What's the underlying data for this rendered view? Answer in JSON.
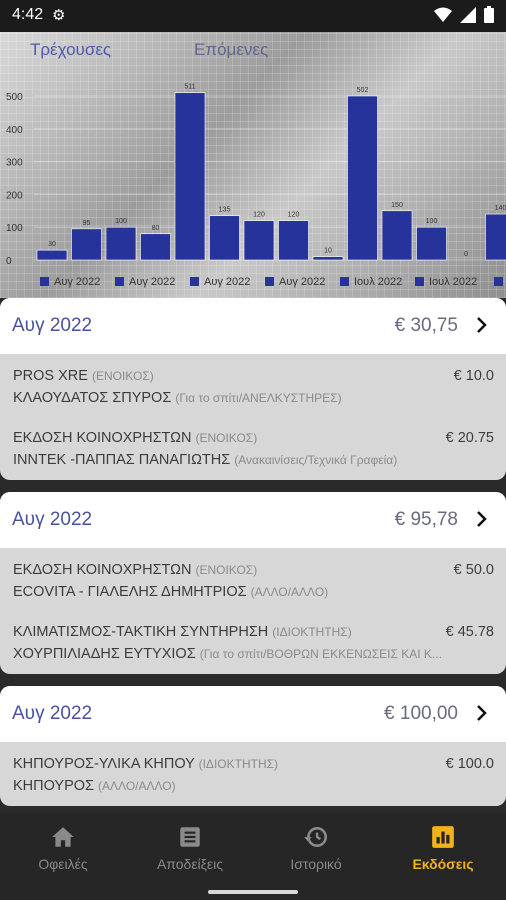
{
  "status": {
    "time": "4:42"
  },
  "chart_tabs": {
    "current": "Τρέχουσες",
    "next": "Επόμενες"
  },
  "chart_data": {
    "type": "bar",
    "values": [
      30,
      95,
      100,
      80,
      510,
      135,
      120,
      120,
      10,
      500,
      150,
      100,
      0,
      140
    ],
    "value_labels": [
      "30",
      "95",
      "100",
      "80",
      "511",
      "135",
      "120",
      "120",
      "10",
      "502",
      "150",
      "100",
      "0",
      "140"
    ],
    "ylim": [
      0,
      520
    ],
    "yticks": [
      0,
      100,
      200,
      300,
      400,
      500
    ],
    "legend": [
      "Αυγ 2022",
      "Αυγ 2022",
      "Αυγ 2022",
      "Αυγ 2022",
      "Ιουλ 2022",
      "Ιουλ 2022"
    ],
    "color": "#26339a"
  },
  "cards": [
    {
      "month": "Αυγ 2022",
      "total": "€ 30,75",
      "items": [
        {
          "title": "PROS XRE",
          "role": "(ΕΝΟΙΚΟΣ)",
          "amount": "€ 10.0",
          "vendor": "ΚΛΑΟΥΔΑΤΟΣ  ΣΠΥΡΟΣ",
          "category": "(Για το σπίτι/ΑΝΕΛΚΥΣΤΗΡΕΣ)"
        },
        {
          "title": "ΕΚΔΟΣΗ ΚΟΙΝΟΧΡΗΣΤΩΝ",
          "role": "(ΕΝΟΙΚΟΣ)",
          "amount": "€ 20.75",
          "vendor": "ΙΝΝΤΕΚ -ΠΑΠΠΑΣ ΠΑΝΑΓΙΩΤΗΣ",
          "category": "(Ανακαινίσεις/Τεχνικά Γραφεία)"
        }
      ]
    },
    {
      "month": "Αυγ 2022",
      "total": "€ 95,78",
      "items": [
        {
          "title": "ΕΚΔΟΣΗ ΚΟΙΝΟΧΡΗΣΤΩΝ",
          "role": "(ΕΝΟΙΚΟΣ)",
          "amount": "€ 50.0",
          "vendor": "ECOVITA - ΓΙΑΛΕΛΗΣ ΔΗΜΗΤΡΙΟΣ",
          "category": "(ΑΛΛΟ/ΑΛΛΟ)"
        },
        {
          "title": "ΚΛΙΜΑΤΙΣΜΟΣ-ΤΑΚΤΙΚΗ ΣΥΝΤΗΡΗΣΗ",
          "role": "(ΙΔΙΟΚΤΗΤΗΣ)",
          "amount": "€ 45.78",
          "vendor": "ΧΟΥΡΠΙΛΙΑΔΗΣ ΕΥΤΥΧΙΟΣ",
          "category": "(Για το σπίτι/ΒΟΘΡΩΝ ΕΚΚΕΝΩΣΕΙΣ ΚΑΙ Κ..."
        }
      ]
    },
    {
      "month": "Αυγ 2022",
      "total": "€ 100,00",
      "items": [
        {
          "title": "ΚΗΠΟΥΡΟΣ-ΥΛΙΚΑ ΚΗΠΟΥ",
          "role": "(ΙΔΙΟΚΤΗΤΗΣ)",
          "amount": "€ 100.0",
          "vendor": "ΚΗΠΟΥΡΟΣ",
          "category": "(ΑΛΛΟ/ΑΛΛΟ)"
        }
      ]
    }
  ],
  "nav": [
    {
      "label": "Οφειλές",
      "icon": "home-icon"
    },
    {
      "label": "Αποδείξεις",
      "icon": "receipt-icon"
    },
    {
      "label": "Ιστορικό",
      "icon": "history-icon"
    },
    {
      "label": "Εκδόσεις",
      "icon": "chart-icon"
    }
  ],
  "colors": {
    "accent": "#f2b21a",
    "bar": "#26339a",
    "month": "#4a52a0"
  }
}
